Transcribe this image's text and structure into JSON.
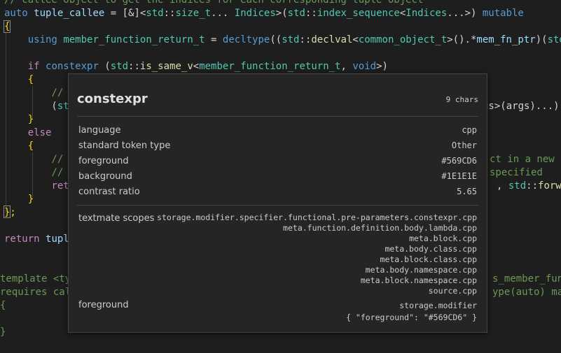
{
  "code": {
    "l01": [
      "// callee object to get the indices for each corresponding tuple object"
    ],
    "l02": [
      "auto",
      " ",
      "tuple_callee",
      " = [&]<",
      "std",
      "::",
      "size_t",
      "... ",
      "Indices",
      ">(",
      "std",
      "::",
      "index_sequence",
      "<",
      "Indices",
      "...>) ",
      "mutable"
    ],
    "l03": [
      "{"
    ],
    "l04": [
      "    ",
      "using",
      " ",
      "member_function_return_t",
      " = ",
      "decltype",
      "((",
      "std",
      "::",
      "declval",
      "<",
      "common_object_t",
      ">().*",
      "mem_fn_ptr",
      ")(",
      "std"
    ],
    "l05": [
      ""
    ],
    "l06": [
      "    ",
      "if",
      " ",
      "constexpr",
      " (",
      "std",
      "::",
      "is_same_v",
      "<",
      "member_function_return_t",
      ", ",
      "void",
      ">)"
    ],
    "l07": [
      "    {"
    ],
    "l08": [
      "        //"
    ],
    "l09": [
      "        (",
      "st",
      "gs>(args)...)"
    ],
    "l10": [
      "    }"
    ],
    "l11": [
      "    ",
      "else"
    ],
    "l12": [
      "    {"
    ],
    "l13": [
      "        //",
      "ct in a new t"
    ],
    "l14": [
      "        //",
      "specified"
    ],
    "l15": [
      "        ",
      "ret",
      ", ",
      "std",
      "::",
      "forwar"
    ],
    "l16": [
      "    }"
    ],
    "l17": [
      "};"
    ],
    "l18": [
      ""
    ],
    "l19": [
      "return",
      " ",
      "tupl"
    ],
    "l20": [
      ""
    ],
    "l21": [
      ""
    ],
    "l22": [
      "template <ty",
      "s_member_func"
    ],
    "l23": [
      "requires cal",
      "ype(auto) map"
    ],
    "l24": [
      "{"
    ],
    "l25": [
      ""
    ],
    "l26": [
      "}"
    ]
  },
  "hover": {
    "token": "constexpr",
    "chars": "9 chars",
    "rows": [
      {
        "key": "language",
        "value": "cpp"
      },
      {
        "key": "standard token type",
        "value": "Other"
      },
      {
        "key": "foreground",
        "value": "#569CD6"
      },
      {
        "key": "background",
        "value": "#1E1E1E"
      },
      {
        "key": "contrast ratio",
        "value": "5.65"
      }
    ],
    "scopes_label": "textmate scopes",
    "scopes": [
      "storage.modifier.specifier.functional.pre-parameters.constexpr.cpp",
      "meta.function.definition.body.lambda.cpp",
      "meta.block.cpp",
      "meta.body.class.cpp",
      "meta.block.class.cpp",
      "meta.body.namespace.cpp",
      "meta.block.namespace.cpp",
      "source.cpp"
    ],
    "fg_label": "foreground",
    "fg_scope": "storage.modifier",
    "fg_json": "{ \"foreground\": \"#569CD6\" }"
  },
  "colors": {
    "editor_bg": "#1E1E1E",
    "keyword": "#569CD6",
    "comment": "#6A9955",
    "type": "#4EC9B0",
    "function": "#DCDCAA",
    "variable": "#9CDCFE",
    "control": "#C586C0",
    "hover_bg": "#252526"
  }
}
